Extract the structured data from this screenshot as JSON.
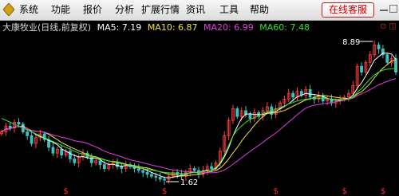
{
  "menu": {
    "items": [
      "系统",
      "功能",
      "报价",
      "分析",
      "扩展行情",
      "资讯",
      "工具",
      "帮助"
    ],
    "online_button": "在线客服"
  },
  "colors": {
    "background": "#000000",
    "price": "#d8d8d8",
    "ma5": "#ffffff",
    "ma10": "#f0e040",
    "ma20": "#e040e0",
    "ma60": "#30e030",
    "up": "#ff4040",
    "down": "#40c0c0",
    "menu_text": "#000000",
    "online_button_text": "#cc0000"
  },
  "chart_header": {
    "stock": "大康牧业(日线,前复权)",
    "ma5": "MA5: 7.19",
    "ma10": "MA10: 6.87",
    "ma20": "MA20: 6.99",
    "ma60": "MA60: 7.48",
    "corner_icons": "⊙ ◫"
  },
  "markers": {
    "high_label": "8.89",
    "low_label": "1.62",
    "event_symbol": "$"
  },
  "chart_data": {
    "type": "candlestick",
    "price_range": [
      1.62,
      8.89
    ],
    "close": [
      4.2,
      4.5,
      4.4,
      4.7,
      4.6,
      4.2,
      4.0,
      3.6,
      3.9,
      4.1,
      3.8,
      3.4,
      3.1,
      3.3,
      3.0,
      3.2,
      2.8,
      2.6,
      2.9,
      3.1,
      2.9,
      2.6,
      2.7,
      2.5,
      2.3,
      2.5,
      2.6,
      2.4,
      2.3,
      2.5,
      2.4,
      2.3,
      2.2,
      2.1,
      2.0,
      1.9,
      1.85,
      1.75,
      1.7,
      1.9,
      2.1,
      2.0,
      1.9,
      2.1,
      2.3,
      2.2,
      2.0,
      2.2,
      2.4,
      2.3,
      2.6,
      3.2,
      4.0,
      4.8,
      5.4,
      5.0,
      5.3,
      5.1,
      4.9,
      5.2,
      5.0,
      5.3,
      5.5,
      5.1,
      5.4,
      5.7,
      5.9,
      6.2,
      6.0,
      6.3,
      6.1,
      6.4,
      6.0,
      5.9,
      6.1,
      5.8,
      5.9,
      5.7,
      5.8,
      5.9,
      6.0,
      6.2,
      6.6,
      7.6,
      7.3,
      7.8,
      8.2,
      8.7,
      8.5,
      8.2,
      7.8,
      8.0,
      7.3
    ],
    "ma60": [
      4.9,
      4.8,
      4.7,
      4.6,
      4.5,
      4.4,
      4.3,
      4.2,
      4.1,
      4.0,
      3.9,
      3.8,
      3.7,
      3.6,
      3.5,
      3.4,
      3.3,
      3.2,
      3.1,
      3.05,
      2.98,
      2.9,
      2.85,
      2.8,
      2.75,
      2.7,
      2.65,
      2.6,
      2.55,
      2.5,
      2.45,
      2.4,
      2.35,
      2.3,
      2.26,
      2.22,
      2.18,
      2.14,
      2.1,
      2.08,
      2.06,
      2.05,
      2.04,
      2.05,
      2.07,
      2.09,
      2.11,
      2.14,
      2.18,
      2.24,
      2.35,
      2.6,
      3.0,
      3.5,
      4.0,
      4.3,
      4.5,
      4.7,
      4.85,
      4.95,
      5.05,
      5.15,
      5.25,
      5.3,
      5.38,
      5.46,
      5.55,
      5.65,
      5.72,
      5.8,
      5.85,
      5.9,
      5.92,
      5.94,
      5.95,
      5.94,
      5.92,
      5.9,
      5.88,
      5.87,
      5.88,
      5.92,
      6.0,
      6.25,
      6.45,
      6.7,
      6.95,
      7.15,
      7.3,
      7.4,
      7.45,
      7.48,
      7.48
    ],
    "event_markers_x_index": [
      15,
      38,
      64,
      80,
      89
    ]
  }
}
